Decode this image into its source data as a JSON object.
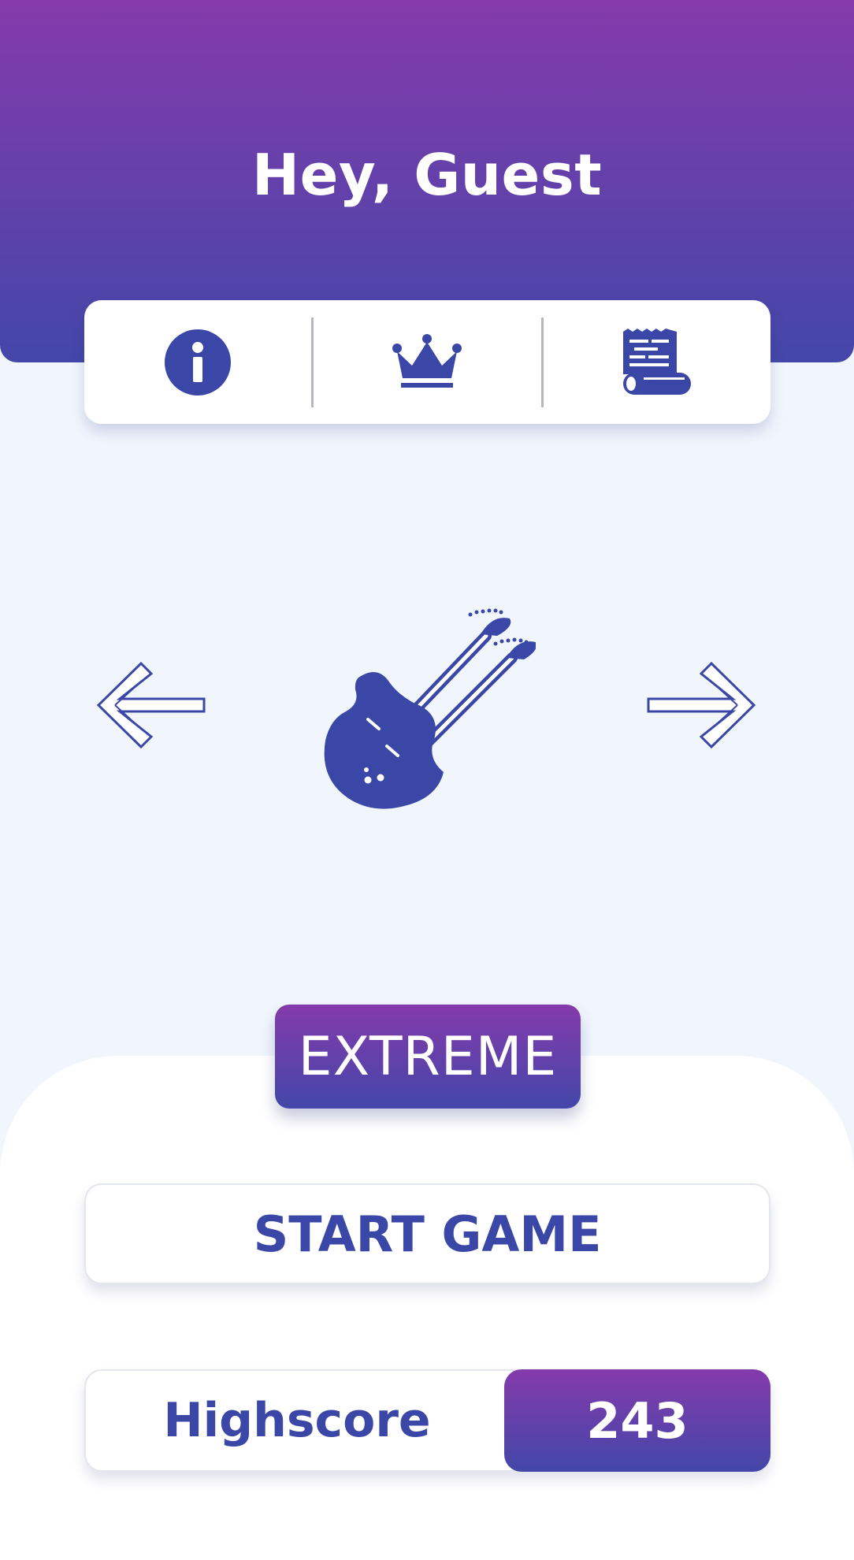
{
  "header": {
    "greeting": "Hey, Guest"
  },
  "toolbar": {
    "items": [
      {
        "icon": "info-icon"
      },
      {
        "icon": "crown-icon"
      },
      {
        "icon": "scroll-icon"
      }
    ]
  },
  "selector": {
    "prev_icon": "arrow-left-icon",
    "next_icon": "arrow-right-icon",
    "instrument_icon": "double-neck-guitar-icon"
  },
  "difficulty": {
    "label": "EXTREME"
  },
  "start_button": {
    "label": "START GAME"
  },
  "highscore": {
    "label": "Highscore",
    "value": "243"
  },
  "colors": {
    "gradient_top": "#853aab",
    "gradient_bottom": "#4347a9",
    "accent": "#3a47a6",
    "background": "#f1f6fd"
  }
}
